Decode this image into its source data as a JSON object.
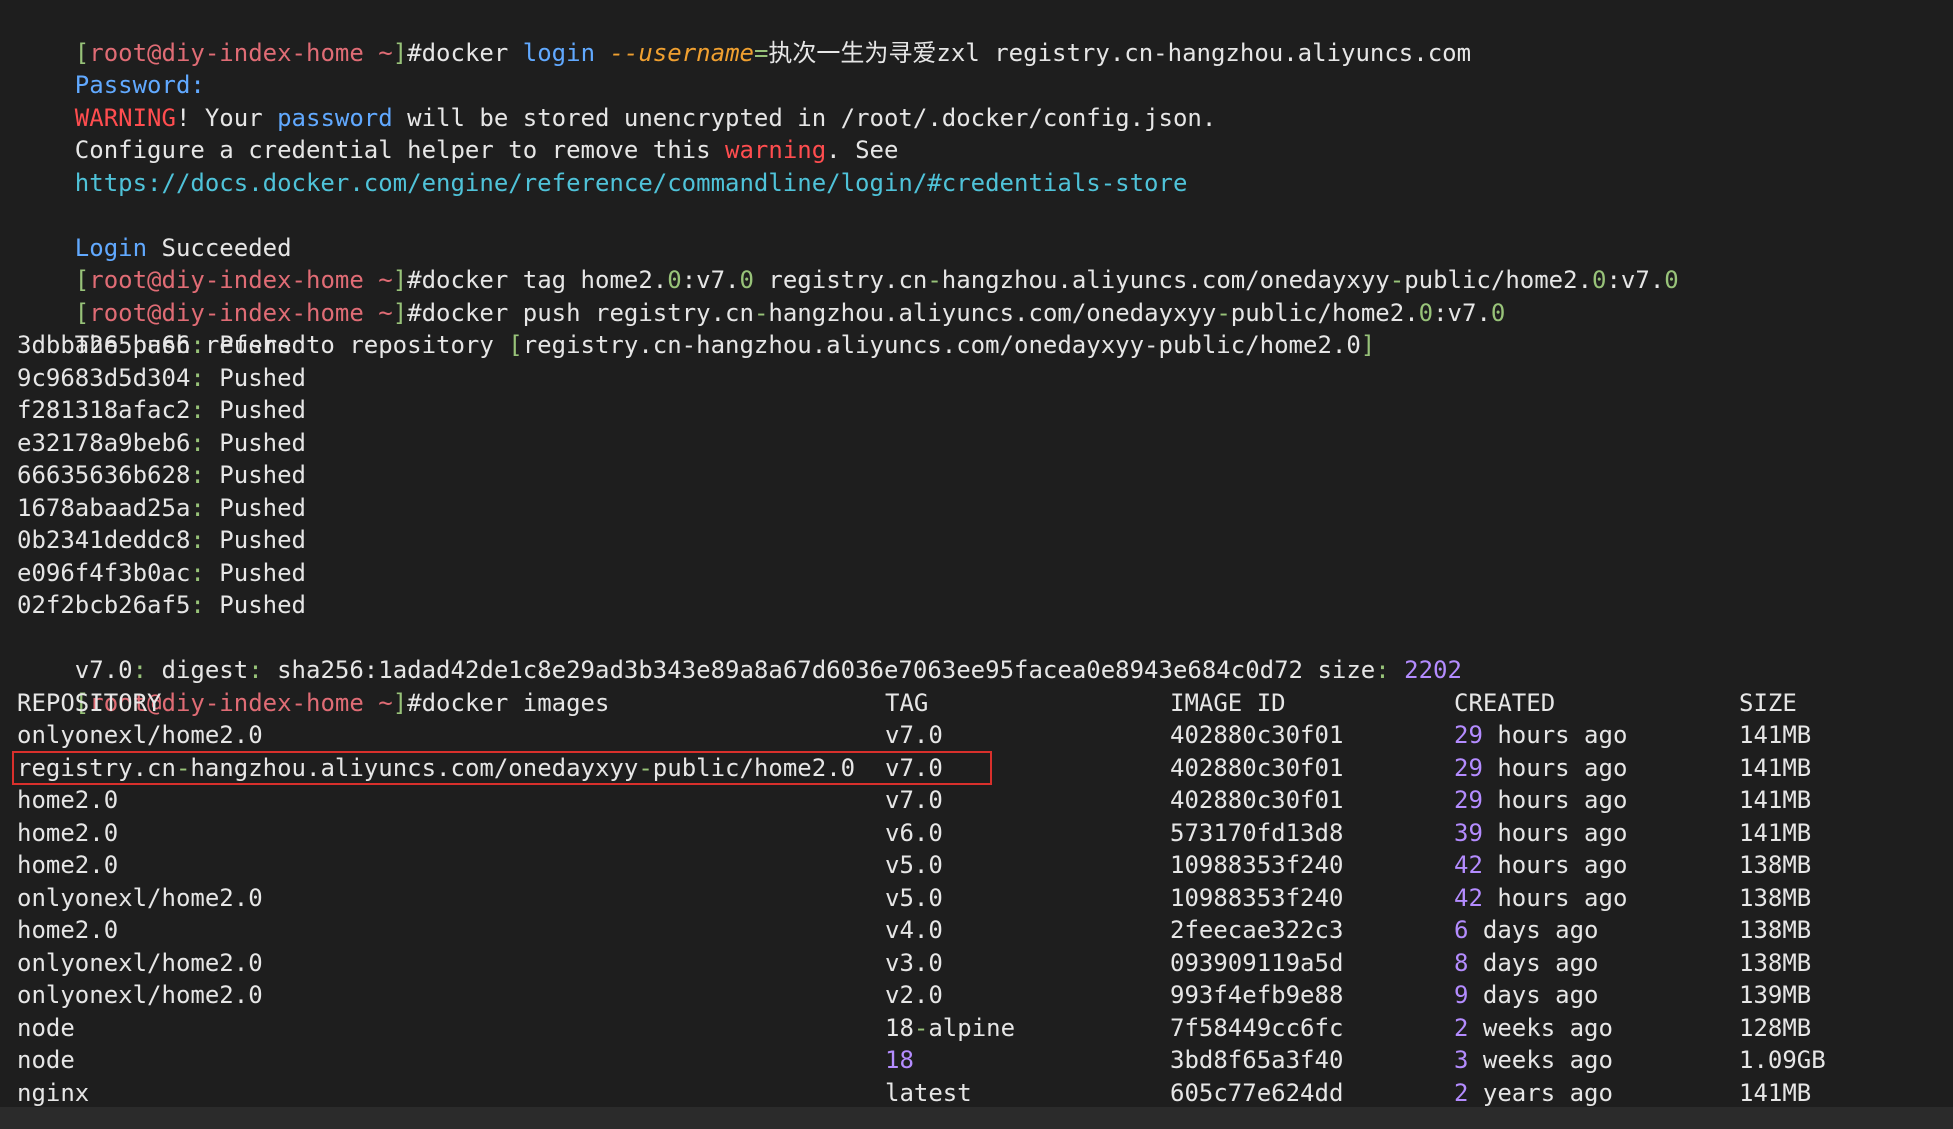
{
  "prompt": {
    "open_bracket": "[",
    "user_host": "root@diy-index-home",
    "path": " ~",
    "close_bracket": "]",
    "hash": "#"
  },
  "login": {
    "cmd_docker": "docker ",
    "cmd_login": "login",
    "space": " ",
    "flag": "--username",
    "equals": "=",
    "username_value": "执次一生为寻爱zxl",
    "registry": " registry.cn-hangzhou.aliyuncs.com",
    "password_prompt": "Password:",
    "warning_word": "WARNING",
    "warning_rest_1": "! Your ",
    "password_word": "password",
    "warning_rest_2": " will be stored unencrypted in /root/.docker/config.json.",
    "configure_1": "Configure a credential helper to remove this ",
    "configure_warning": "warning",
    "configure_2": ". See",
    "docs_url": "https://docs.docker.com/engine/reference/commandline/login/#credentials-store",
    "login_word": "Login",
    "succeeded": " Succeeded"
  },
  "tag_cmd": {
    "part1": "docker tag home2.",
    "part2": "0",
    "part3": ":v7.",
    "part4": "0",
    "part5": " registry.cn",
    "dash1": "-",
    "part6": "hangzhou.aliyuncs.com/onedayxyy",
    "dash2": "-",
    "part7": "public/home2.",
    "part8": "0",
    "part9": ":v7.",
    "part10": "0"
  },
  "push_cmd": {
    "part1": "docker push registry.cn",
    "dash1": "-",
    "part2": "hangzhou.aliyuncs.com/onedayxyy",
    "dash2": "-",
    "part3": "public/home2.",
    "part4": "0",
    "part5": ":v7.",
    "part6": "0"
  },
  "push_output": {
    "refers": "The push refers to repository ",
    "repo_open": "[",
    "repo": "registry.cn-hangzhou.aliyuncs.com/onedayxyy-public/home2.0",
    "repo_close": "]",
    "colon": ":",
    "pushed": " Pushed",
    "layers": [
      "3dbba265ba66",
      "9c9683d5d304",
      "f281318afac2",
      "e32178a9beb6",
      "66635636b628",
      "1678abaad25a",
      "0b2341deddc8",
      "e096f4f3b0ac",
      "02f2bcb26af5"
    ],
    "digest_tag": "v7.0",
    "digest_colon": ":",
    "digest_label": " digest",
    "digest_colon2": ":",
    "digest_value": " sha256:1adad42de1c8e29ad3b343e89a8a67d6036e7063ee95facea0e8943e684c0d72",
    "size_label": " size",
    "size_colon": ":",
    "size_value": " 2202"
  },
  "images_cmd": "docker images",
  "images_table": {
    "headers": {
      "repository": "REPOSITORY",
      "tag": "TAG",
      "image_id": "IMAGE ID",
      "created": "CREATED",
      "size": "SIZE"
    },
    "rows": [
      {
        "repo": "onlyonexl/home2.0",
        "tag": "v7.0",
        "id": "402880c30f01",
        "created_num": "29",
        "created_rest": " hours ago",
        "size": "141MB"
      },
      {
        "repo": "registry.cn-hangzhou.aliyuncs.com/onedayxyy-public/home2.0",
        "tag": "v7.0",
        "id": "402880c30f01",
        "created_num": "29",
        "created_rest": " hours ago",
        "size": "141MB"
      },
      {
        "repo": "home2.0",
        "tag": "v7.0",
        "id": "402880c30f01",
        "created_num": "29",
        "created_rest": " hours ago",
        "size": "141MB"
      },
      {
        "repo": "home2.0",
        "tag": "v6.0",
        "id": "573170fd13d8",
        "created_num": "39",
        "created_rest": " hours ago",
        "size": "141MB"
      },
      {
        "repo": "home2.0",
        "tag": "v5.0",
        "id": "10988353f240",
        "created_num": "42",
        "created_rest": " hours ago",
        "size": "138MB"
      },
      {
        "repo": "onlyonexl/home2.0",
        "tag": "v5.0",
        "id": "10988353f240",
        "created_num": "42",
        "created_rest": " hours ago",
        "size": "138MB"
      },
      {
        "repo": "home2.0",
        "tag": "v4.0",
        "id": "2feecae322c3",
        "created_num": "6",
        "created_rest": " days ago",
        "size": "138MB"
      },
      {
        "repo": "onlyonexl/home2.0",
        "tag": "v3.0",
        "id": "093909119a5d",
        "created_num": "8",
        "created_rest": " days ago",
        "size": "138MB"
      },
      {
        "repo": "onlyonexl/home2.0",
        "tag": "v2.0",
        "id": "993f4efb9e88",
        "created_num": "9",
        "created_rest": " days ago",
        "size": "139MB"
      },
      {
        "repo": "node",
        "tag": "18-alpine",
        "id": "7f58449cc6fc",
        "created_num": "2",
        "created_rest": " weeks ago",
        "size": "128MB"
      },
      {
        "repo": "node",
        "tag": "18",
        "id": "3bd8f65a3f40",
        "created_num": "3",
        "created_rest": " weeks ago",
        "size": "1.09GB"
      },
      {
        "repo": "nginx",
        "tag": "latest",
        "id": "605c77e624dd",
        "created_num": "2",
        "created_rest": " years ago",
        "size": "141MB"
      }
    ]
  },
  "colors": {
    "background": "#1e1e1e",
    "prompt_green": "#98c379",
    "prompt_salmon": "#e06c75",
    "warning_red": "#ff4d4f",
    "keyword_blue": "#61a9ff",
    "link_cyan": "#4fc3d9",
    "flag_orange": "#f0a030",
    "number_purple": "#b48cff",
    "highlight_box": "#d9302c",
    "cursor": "#f0a000"
  }
}
